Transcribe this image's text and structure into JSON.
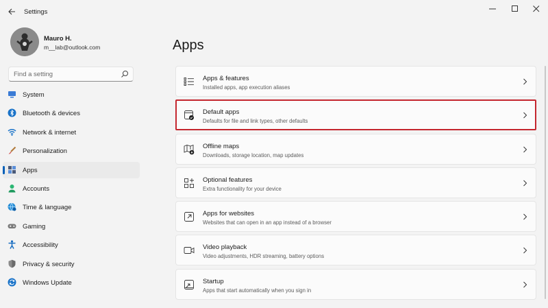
{
  "window": {
    "title": "Settings"
  },
  "profile": {
    "name": "Mauro H.",
    "email": "m__lab@outlook.com"
  },
  "search": {
    "placeholder": "Find a setting"
  },
  "nav": {
    "items": [
      {
        "label": "System",
        "icon": "monitor-icon"
      },
      {
        "label": "Bluetooth & devices",
        "icon": "bluetooth-icon"
      },
      {
        "label": "Network & internet",
        "icon": "wifi-icon"
      },
      {
        "label": "Personalization",
        "icon": "brush-icon"
      },
      {
        "label": "Apps",
        "icon": "apps-icon",
        "selected": true
      },
      {
        "label": "Accounts",
        "icon": "person-icon"
      },
      {
        "label": "Time & language",
        "icon": "globe-clock-icon"
      },
      {
        "label": "Gaming",
        "icon": "gamepad-icon"
      },
      {
        "label": "Accessibility",
        "icon": "accessibility-icon"
      },
      {
        "label": "Privacy & security",
        "icon": "shield-icon"
      },
      {
        "label": "Windows Update",
        "icon": "update-icon"
      }
    ]
  },
  "main": {
    "title": "Apps",
    "cards": [
      {
        "title": "Apps & features",
        "subtitle": "Installed apps, app execution aliases",
        "icon": "list-icon"
      },
      {
        "title": "Default apps",
        "subtitle": "Defaults for file and link types, other defaults",
        "icon": "default-apps-icon",
        "highlighted": true
      },
      {
        "title": "Offline maps",
        "subtitle": "Downloads, storage location, map updates",
        "icon": "map-icon"
      },
      {
        "title": "Optional features",
        "subtitle": "Extra functionality for your device",
        "icon": "grid-add-icon"
      },
      {
        "title": "Apps for websites",
        "subtitle": "Websites that can open in an app instead of a browser",
        "icon": "open-link-icon"
      },
      {
        "title": "Video playback",
        "subtitle": "Video adjustments, HDR streaming, battery options",
        "icon": "video-icon"
      },
      {
        "title": "Startup",
        "subtitle": "Apps that start automatically when you sign in",
        "icon": "startup-icon"
      }
    ]
  },
  "colors": {
    "accent": "#005fb8",
    "highlight_border": "#c4262e",
    "background": "#f3f3f3",
    "card": "#fbfbfb"
  }
}
